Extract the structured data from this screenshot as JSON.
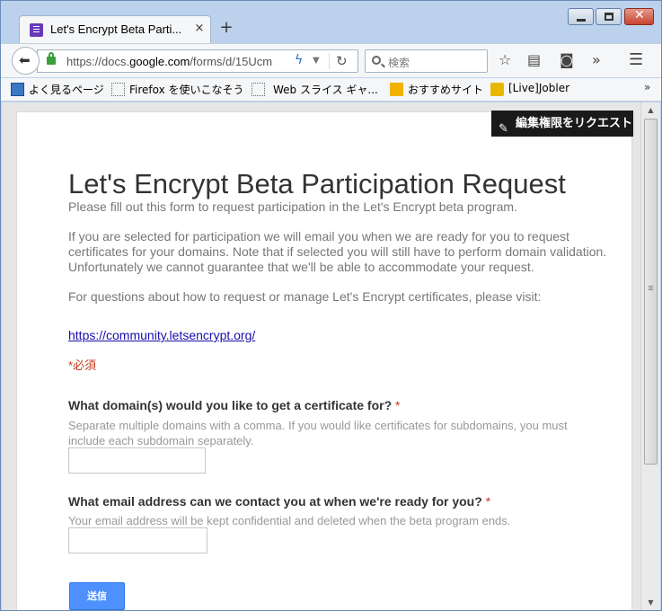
{
  "browser": {
    "tab_title": "Let's Encrypt Beta Parti...",
    "tab_close": "×",
    "new_tab": "+",
    "url_prefix": "https://docs.",
    "url_domain": "google.com",
    "url_suffix": "/forms/d/15Ucm",
    "search_placeholder": "検索",
    "bookmarks": [
      {
        "label": "よく見るページ",
        "icon": "globe-icon"
      },
      {
        "label": "Firefox を使いこなそう",
        "icon": "dotted-page-icon"
      },
      {
        "label": "Web スライス ギャ...",
        "icon": "dotted-page-icon"
      },
      {
        "label": "おすすめサイト",
        "icon": "bing-icon"
      },
      {
        "label": "[Live]Jobler",
        "icon": "live-icon"
      }
    ],
    "bookmarks_overflow": "»"
  },
  "page": {
    "edit_request_label": "編集権限をリクエスト",
    "title": "Let's Encrypt Beta Participation Request",
    "intro": "Please fill out this form to request participation in the Let's Encrypt beta program.",
    "description": "If you are selected for participation we will email you when we are ready for you to request certificates for your domains. Note that if selected you will still have to perform domain validation. Unfortunately we cannot guarantee that we'll be able to accommodate your request.",
    "questions_note": "For questions about how to request or manage Let's Encrypt certificates, please visit:",
    "community_link": "https://community.letsencrypt.org/",
    "required_note": "*必須",
    "q1_label": "What domain(s) would you like to get a certificate for?",
    "q1_help": "Separate multiple domains with a comma. If you would like certificates for subdomains, you must include each subdomain separately.",
    "q1_value": "",
    "q2_label": "What email address can we contact you at when we're ready for you?",
    "q2_help": "Your email address will be kept confidential and deleted when the beta program ends.",
    "q2_value": "",
    "required_star": "*",
    "submit_label": "送信"
  },
  "colors": {
    "submit": "#4d90fe",
    "required": "#c43b1d",
    "link": "#1a0dab"
  }
}
